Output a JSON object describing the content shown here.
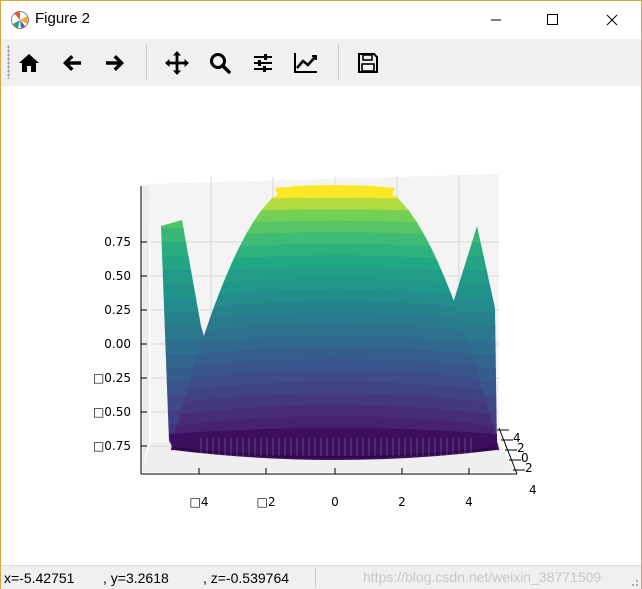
{
  "window": {
    "title": "Figure 2"
  },
  "toolbar": {
    "buttons": [
      {
        "name": "home",
        "icon": "home-icon"
      },
      {
        "name": "back",
        "icon": "arrow-left-icon"
      },
      {
        "name": "forward",
        "icon": "arrow-right-icon"
      },
      {
        "name": "pan",
        "icon": "move-icon"
      },
      {
        "name": "zoom",
        "icon": "magnifier-icon"
      },
      {
        "name": "configure",
        "icon": "sliders-icon"
      },
      {
        "name": "edit-axes",
        "icon": "line-chart-icon"
      },
      {
        "name": "save",
        "icon": "floppy-icon"
      }
    ]
  },
  "status": {
    "x": "x=-5.42751",
    "y": ", y=3.2618",
    "z": ", z=-0.539764",
    "watermark": "https://blog.csdn.net/weixin_38771509"
  },
  "chart_data": {
    "type": "surface3d",
    "colormap": "viridis",
    "grid": true,
    "x_ticks": [
      "□4",
      "□2",
      "0",
      "2",
      "4"
    ],
    "z_ticks": [
      "0.75",
      "0.50",
      "0.25",
      "0.00",
      "□0.25",
      "□0.50",
      "□0.75"
    ],
    "y_ticks": [
      "4",
      "2",
      "0",
      "2",
      "4"
    ],
    "x_range": [
      -5,
      5
    ],
    "y_range": [
      -5,
      5
    ],
    "z_range": [
      -1,
      1
    ]
  }
}
